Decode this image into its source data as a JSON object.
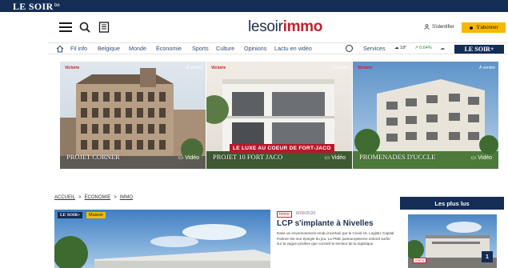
{
  "topbar": {
    "brand": "LE SOIR",
    "brand_sub": "be"
  },
  "header": {
    "logo_part1": "lesoir",
    "logo_part2": "immo",
    "login_label": "S'identifier",
    "subscribe_label": "S'abonner"
  },
  "nav": {
    "items": [
      "Fil info",
      "Belgique",
      "Monde",
      "Économie",
      "Sports",
      "Culture",
      "Opinions",
      "Lactu en vidéo",
      "Services"
    ],
    "weather": "18°",
    "stock": "0.64%",
    "lesoirplus": "LE SOIR+"
  },
  "tiles": [
    {
      "caption": "PROJET CORNER",
      "badge": "À vendre",
      "brand": "Victoire",
      "video": "Vidéo"
    },
    {
      "caption": "PROJET 10 FORT JACO",
      "badge": "À vendre",
      "brand": "Victoire",
      "video": "Vidéo",
      "banner": "LE LUXE AU COEUR DE FORT-JACO"
    },
    {
      "caption": "PROMENADES D'UCCLE",
      "badge": "À vendre",
      "brand": "Victoire",
      "video": "Vidéo"
    }
  ],
  "breadcrumb": [
    "ACCUEIL",
    "ÉCONOMIE",
    "IMMO"
  ],
  "article": {
    "lesoir_tag": "LE SOIR+",
    "mag_tag": "Maison",
    "tag": "Immo",
    "date": "8/09/2020",
    "title": "LCP s'implante à Nivelles",
    "body": "Dans un environnement rendu incertain par le Covid 19, Logistic Capital Partner tire son épingle du jeu. La PME paneuropéenne entend surfer sur la vague positive que connaît le secteur de la logistique."
  },
  "sidebar": {
    "heading": "Les plus lus",
    "rank": "1",
    "tag": "Immo"
  },
  "colors": {
    "navy": "#132d55",
    "accent_red": "#c4202f",
    "subscribe_yellow": "#f6b800"
  }
}
